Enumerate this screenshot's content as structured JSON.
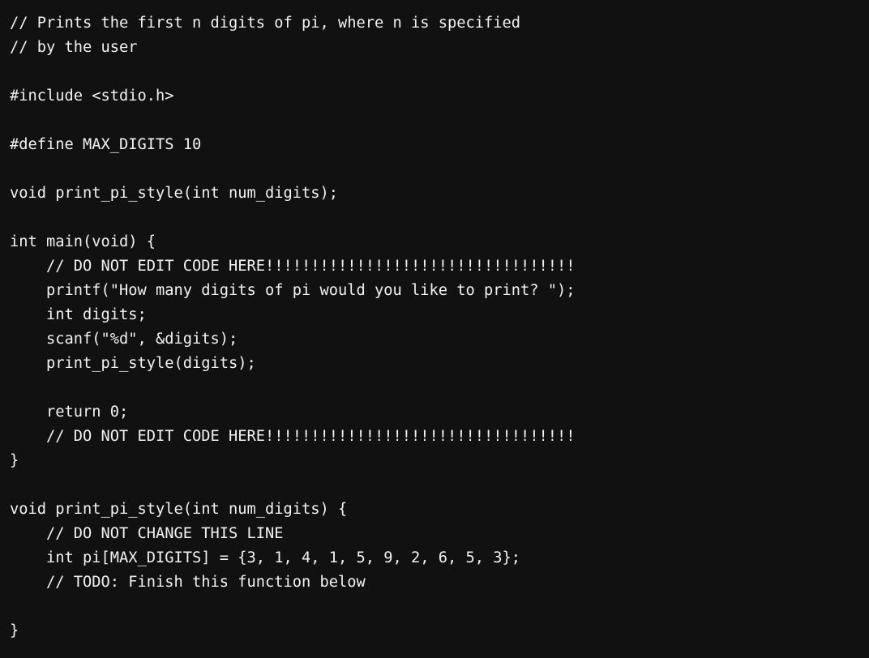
{
  "editor": {
    "language": "c",
    "background_color": "#111111",
    "text_color": "#f2f2f2",
    "filename_hint": "",
    "lines": [
      "// Prints the first n digits of pi, where n is specified",
      "// by the user",
      "",
      "#include <stdio.h>",
      "",
      "#define MAX_DIGITS 10",
      "",
      "void print_pi_style(int num_digits);",
      "",
      "int main(void) {",
      "    // DO NOT EDIT CODE HERE!!!!!!!!!!!!!!!!!!!!!!!!!!!!!!!!!!",
      "    printf(\"How many digits of pi would you like to print? \");",
      "    int digits;",
      "    scanf(\"%d\", &digits);",
      "    print_pi_style(digits);",
      "",
      "    return 0;",
      "    // DO NOT EDIT CODE HERE!!!!!!!!!!!!!!!!!!!!!!!!!!!!!!!!!!",
      "}",
      "",
      "void print_pi_style(int num_digits) {",
      "    // DO NOT CHANGE THIS LINE",
      "    int pi[MAX_DIGITS] = {3, 1, 4, 1, 5, 9, 2, 6, 5, 3};",
      "    // TODO: Finish this function below",
      "",
      "}"
    ]
  }
}
